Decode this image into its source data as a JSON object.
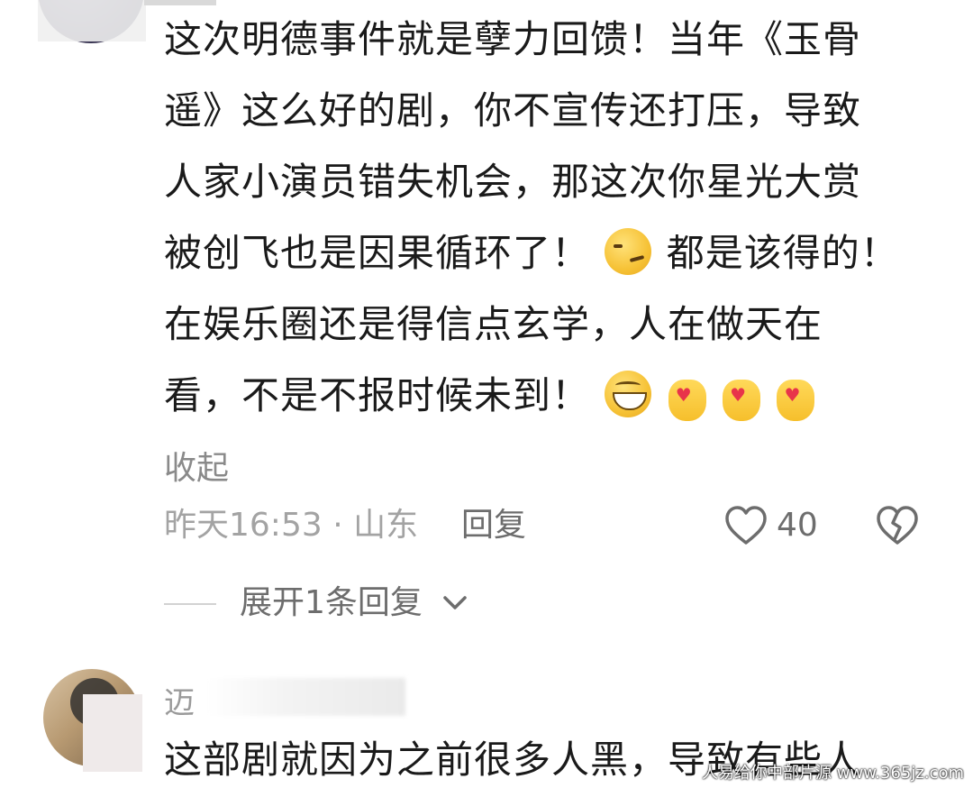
{
  "comment": {
    "lines": [
      "这次明德事件就是孽力回馈！当年《玉骨",
      "遥》这么好的剧，你不宣传还打压，导致",
      "人家小演员错失机会，那这次你星光大赏",
      "被创飞也是因果循环了！",
      "都是该得的！",
      "在娱乐圈还是得信点玄学，人在做天在",
      "看，不是不报时候未到！"
    ],
    "collapse_label": "收起",
    "timestamp": "昨天16:53 · 山东",
    "reply_label": "回复",
    "like_count": "40",
    "expand_label": "展开1条回复"
  },
  "reply": {
    "username": "迈",
    "text": "这部剧就因为之前很多人黑，导致有些人"
  },
  "watermark": "人易给你中部片源 www.365jz.com",
  "colors": {
    "text": "#1a1a1a",
    "meta": "#a3a3a3",
    "secondary": "#6d6d6d"
  }
}
